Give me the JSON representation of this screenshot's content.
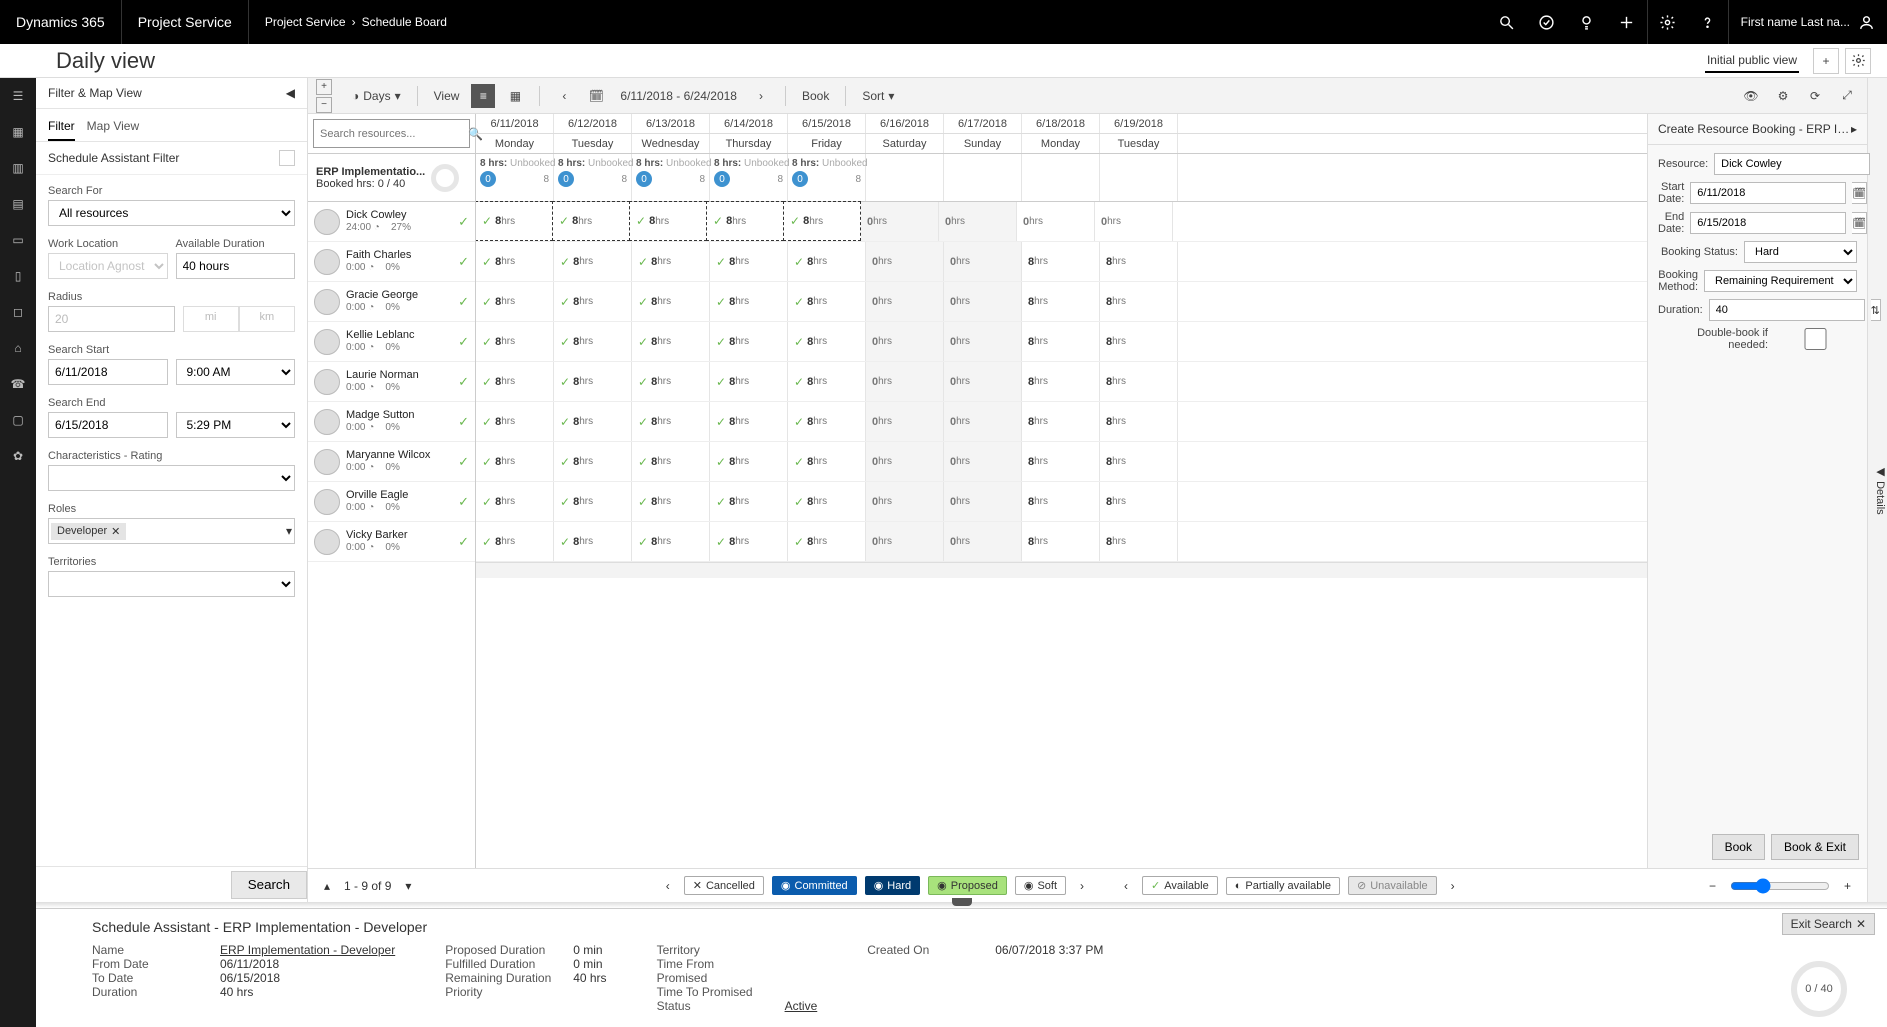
{
  "top": {
    "brand": "Dynamics 365",
    "service": "Project Service",
    "crumb1": "Project Service",
    "crumb2": "Schedule Board",
    "user": "First name Last na..."
  },
  "title": {
    "heading": "Daily view",
    "view": "Initial public view"
  },
  "filter": {
    "panel_title": "Filter & Map View",
    "tab_filter": "Filter",
    "tab_map": "Map View",
    "subheader": "Schedule Assistant Filter",
    "search_for_label": "Search For",
    "search_for_value": "All resources",
    "work_location_label": "Work Location",
    "work_location_value": "Location Agnostic",
    "avail_duration_label": "Available Duration",
    "avail_duration_value": "40 hours",
    "radius_label": "Radius",
    "radius_value": "20",
    "radius_unit_mi": "mi",
    "radius_unit_km": "km",
    "search_start_label": "Search Start",
    "search_start_date": "6/11/2018",
    "search_start_time": "9:00 AM",
    "search_end_label": "Search End",
    "search_end_date": "6/15/2018",
    "search_end_time": "5:29 PM",
    "characteristics_label": "Characteristics - Rating",
    "roles_label": "Roles",
    "roles_chip": "Developer",
    "territories_label": "Territories",
    "search_button": "Search"
  },
  "toolbar": {
    "days": "Days",
    "view": "View",
    "daterange": "6/11/2018 - 6/24/2018",
    "book": "Book",
    "sort": "Sort"
  },
  "grid": {
    "search_placeholder": "Search resources...",
    "erp_title": "ERP Implementatio...",
    "erp_sub": "Booked hrs: 0 / 40",
    "dates": [
      "6/11/2018",
      "6/12/2018",
      "6/13/2018",
      "6/14/2018",
      "6/15/2018",
      "6/16/2018",
      "6/17/2018",
      "6/18/2018",
      "6/19/2018"
    ],
    "dows": [
      "Monday",
      "Tuesday",
      "Wednesday",
      "Thursday",
      "Friday",
      "Saturday",
      "Sunday",
      "Monday",
      "Tuesday"
    ],
    "summary_label": "8 hrs:",
    "summary_sub": "Unbooked",
    "summary_remaining": "8",
    "summary_pill": "0",
    "resources": [
      {
        "name": "Dick Cowley",
        "hrs": "24:00",
        "pct": "27%",
        "avc": "av1",
        "selected": true
      },
      {
        "name": "Faith Charles",
        "hrs": "0:00",
        "pct": "0%",
        "avc": "av2"
      },
      {
        "name": "Gracie George",
        "hrs": "0:00",
        "pct": "0%",
        "avc": "av3"
      },
      {
        "name": "Kellie Leblanc",
        "hrs": "0:00",
        "pct": "0%",
        "avc": "av4"
      },
      {
        "name": "Laurie Norman",
        "hrs": "0:00",
        "pct": "0%",
        "avc": "av5"
      },
      {
        "name": "Madge Sutton",
        "hrs": "0:00",
        "pct": "0%",
        "avc": "av6"
      },
      {
        "name": "Maryanne Wilcox",
        "hrs": "0:00",
        "pct": "0%",
        "avc": "av7"
      },
      {
        "name": "Orville Eagle",
        "hrs": "0:00",
        "pct": "0%",
        "avc": "av8"
      },
      {
        "name": "Vicky Barker",
        "hrs": "0:00",
        "pct": "0%",
        "avc": "av9"
      }
    ],
    "cell_avail": "8",
    "cell_avail_unit": "hrs",
    "cell_zero": "0",
    "cell_zero_unit": "hrs",
    "cell_big8": "8"
  },
  "status": {
    "pager": "1 - 9 of 9",
    "cancelled": "Cancelled",
    "committed": "Committed",
    "hard": "Hard",
    "proposed": "Proposed",
    "soft": "Soft",
    "available": "Available",
    "partial": "Partially available",
    "unavailable": "Unavailable"
  },
  "booking": {
    "title": "Create Resource Booking - ERP Impler",
    "resource_label": "Resource:",
    "resource_value": "Dick Cowley",
    "start_label": "Start Date:",
    "start_value": "6/11/2018",
    "end_label": "End Date:",
    "end_value": "6/15/2018",
    "status_label": "Booking Status:",
    "status_value": "Hard",
    "method_label": "Booking Method:",
    "method_value": "Remaining Requirement",
    "duration_label": "Duration:",
    "duration_value": "40",
    "dbl_label": "Double-book if needed:",
    "btn_book": "Book",
    "btn_book_exit": "Book & Exit"
  },
  "details_flap": "Details",
  "bottom": {
    "title": "Schedule Assistant - ERP Implementation - Developer",
    "exit": "Exit Search",
    "name_k": "Name",
    "name_v": "ERP Implementation - Developer",
    "from_k": "From Date",
    "from_v": "06/11/2018",
    "to_k": "To Date",
    "to_v": "06/15/2018",
    "dur_k": "Duration",
    "dur_v": "40 hrs",
    "prop_k": "Proposed Duration",
    "prop_v": "0 min",
    "fulf_k": "Fulfilled Duration",
    "fulf_v": "0 min",
    "rem_k": "Remaining Duration",
    "rem_v": "40 hrs",
    "prio_k": "Priority",
    "prio_v": "",
    "terr_k": "Territory",
    "terr_v": "",
    "tfp_k": "Time From Promised",
    "tfp_v": "",
    "ttp_k": "Time To Promised",
    "ttp_v": "",
    "stat_k": "Status",
    "stat_v": "Active",
    "created_k": "Created On",
    "created_v": "06/07/2018 3:37 PM",
    "gauge": "0 / 40"
  }
}
